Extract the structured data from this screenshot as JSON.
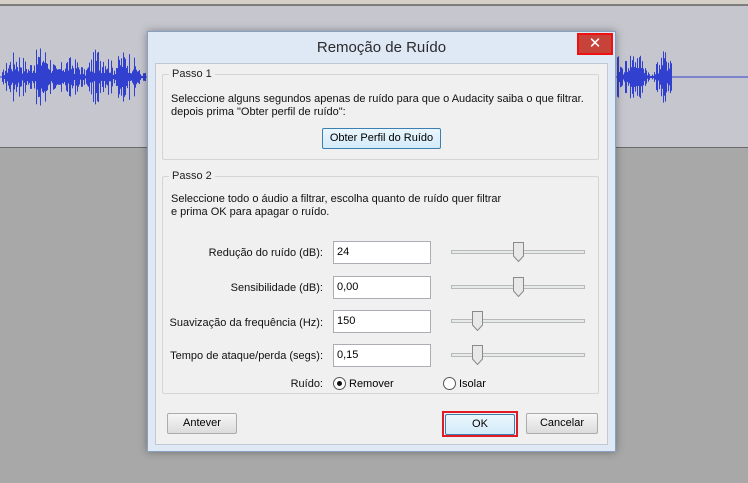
{
  "dialog": {
    "title": "Remoção de Ruído",
    "close_icon": "close-icon"
  },
  "step1": {
    "legend": "Passo 1",
    "instruction_line1": "Seleccione alguns segundos apenas de ruído para que o Audacity saiba o que filtrar.",
    "instruction_line2": "depois prima \"Obter perfil de ruído\":",
    "get_profile_button": "Obter Perfil do Ruído"
  },
  "step2": {
    "legend": "Passo 2",
    "instruction_line1": "Seleccione todo o áudio a filtrar, escolha quanto de ruído quer filtrar",
    "instruction_line2": "e prima OK para apagar o ruído.",
    "rows": [
      {
        "label": "Redução do ruído (dB):",
        "value": "24",
        "slider_fraction": 0.5
      },
      {
        "label": "Sensibilidade (dB):",
        "value": "0,00",
        "slider_fraction": 0.5
      },
      {
        "label": "Suavização da frequência (Hz):",
        "value": "150",
        "slider_fraction": 0.17
      },
      {
        "label": "Tempo de ataque/perda (segs):",
        "value": "0,15",
        "slider_fraction": 0.17
      }
    ],
    "noise_label": "Ruído:",
    "remove_option": "Remover",
    "isolate_option": "Isolar",
    "selected_option": "Remover"
  },
  "buttons": {
    "preview": "Antever",
    "ok": "OK",
    "cancel": "Cancelar"
  },
  "colors": {
    "waveform": "#3240d0",
    "highlight": "#e01b24"
  }
}
